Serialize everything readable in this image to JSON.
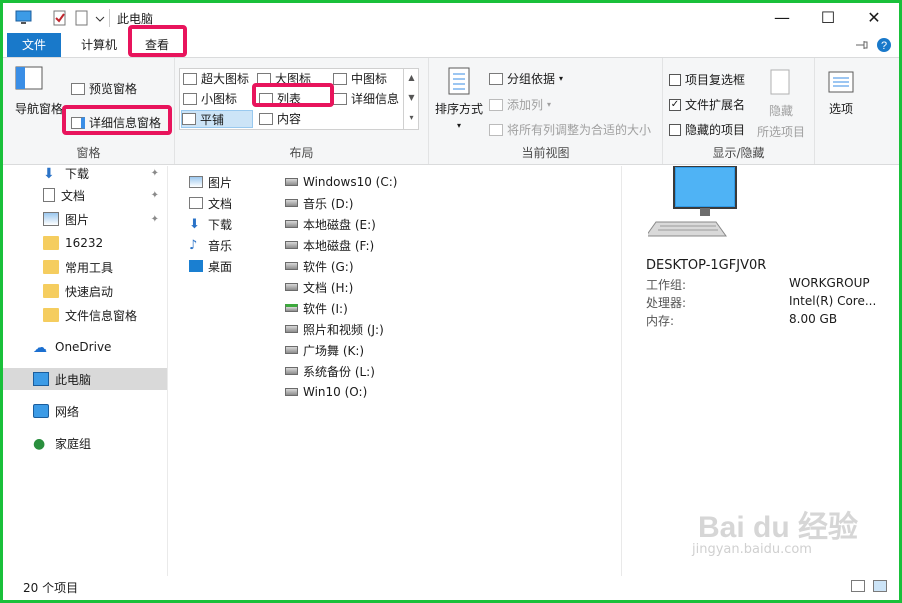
{
  "window": {
    "title": "此电脑",
    "minimize_glyph": "—",
    "maximize_glyph": "☐",
    "close_glyph": "✕"
  },
  "tabs": {
    "file": "文件",
    "computer": "计算机",
    "view": "查看"
  },
  "ribbon": {
    "panes": {
      "nav_pane": "导航窗格",
      "preview_pane": "预览窗格",
      "details_pane": "详细信息窗格",
      "title": "窗格"
    },
    "layout": {
      "extra_large_icons": "超大图标",
      "large_icons": "大图标",
      "medium_icons": "中图标",
      "small_icons": "小图标",
      "list": "列表",
      "details": "详细信息",
      "tiles": "平铺",
      "content": "内容",
      "title": "布局"
    },
    "current_view": {
      "sort_by": "排序方式",
      "group_by": "分组依据",
      "add_columns": "添加列",
      "size_all_columns": "将所有列调整为合适的大小",
      "title": "当前视图"
    },
    "show_hide": {
      "item_checkboxes": "项目复选框",
      "file_extensions": "文件扩展名",
      "hidden_items": "隐藏的项目",
      "hide": "隐藏",
      "selected_items": "所选项目",
      "title": "显示/隐藏",
      "item_checkboxes_checked": false,
      "file_extensions_checked": true,
      "hidden_items_checked": false
    },
    "options": {
      "label": "选项"
    }
  },
  "nav": {
    "items": [
      {
        "label": "下载",
        "icon": "download-icon"
      },
      {
        "label": "文档",
        "icon": "document-icon"
      },
      {
        "label": "图片",
        "icon": "picture-icon"
      },
      {
        "label": "16232",
        "icon": "folder-icon"
      },
      {
        "label": "常用工具",
        "icon": "folder-icon"
      },
      {
        "label": "快速启动",
        "icon": "folder-icon"
      },
      {
        "label": "文件信息窗格",
        "icon": "folder-icon"
      },
      {
        "label": "OneDrive",
        "icon": "cloud-icon"
      },
      {
        "label": "此电脑",
        "icon": "computer-icon"
      },
      {
        "label": "网络",
        "icon": "network-icon"
      },
      {
        "label": "家庭组",
        "icon": "homegroup-icon"
      }
    ]
  },
  "content": {
    "folders": [
      "图片",
      "文档",
      "下载",
      "音乐",
      "桌面"
    ],
    "drives": [
      "Windows10 (C:)",
      "音乐 (D:)",
      "本地磁盘 (E:)",
      "本地磁盘 (F:)",
      "软件 (G:)",
      "文档 (H:)",
      "软件   (I:)",
      "照片和视频 (J:)",
      "广场舞 (K:)",
      "系统备份 (L:)",
      "Win10 (O:)"
    ]
  },
  "details": {
    "computer_name": "DESKTOP-1GFJV0R",
    "rows": [
      {
        "label": "工作组:",
        "value": "WORKGROUP"
      },
      {
        "label": "处理器:",
        "value": "Intel(R) Core..."
      },
      {
        "label": "内存:",
        "value": "8.00 GB"
      }
    ]
  },
  "status": {
    "item_count": "20 个项目"
  },
  "watermark": {
    "brand": "Bai du 经验",
    "url": "jingyan.baidu.com"
  },
  "colors": {
    "accent": "#1979ca",
    "highlight": "#e8145c",
    "frame": "#19c03a"
  }
}
